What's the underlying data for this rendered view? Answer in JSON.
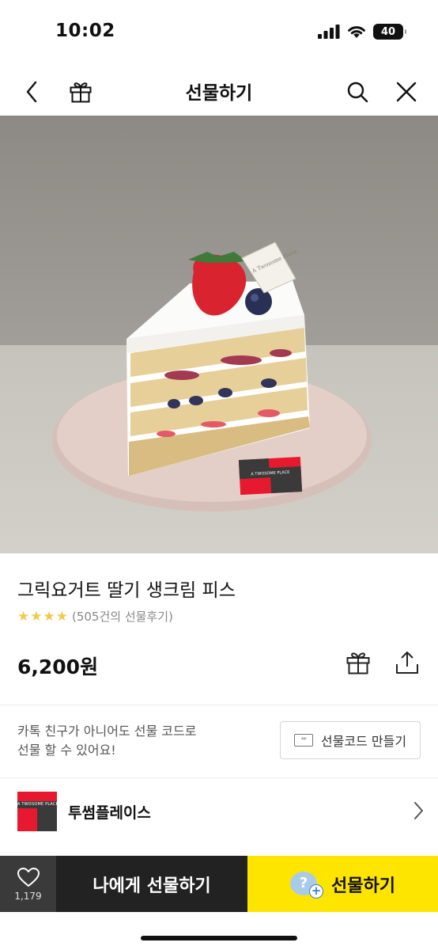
{
  "status_bar": {
    "time": "10:02",
    "battery": "40"
  },
  "nav": {
    "title": "선물하기"
  },
  "product": {
    "name": "그릭요거트 딸기 생크림 피스",
    "stars": "★★★★",
    "review_text": "(505건의 선물후기)",
    "price": "6,200원",
    "image_tag_text": "A TWOSOME PLACE",
    "topper_text": "A Twosome Place"
  },
  "gift_code": {
    "text": "카톡 친구가 아니어도 선물 코드로\n선물 할 수 있어요!",
    "button_label": "선물코드 만들기",
    "ticket_glyph": "**"
  },
  "brand": {
    "name": "투썸플레이스",
    "logo_text": "A TWOSOME PLACE"
  },
  "bottom_bar": {
    "like_count": "1,179",
    "self_gift_label": "나에게 선물하기",
    "gift_label": "선물하기",
    "gift_badge_glyph": "?",
    "gift_badge_plus": "+"
  },
  "colors": {
    "kakao_yellow": "#fee500",
    "dark_button": "#222222",
    "like_bg": "#3a3a3a",
    "star": "#f2c94c",
    "brand_red": "#e6192e"
  }
}
